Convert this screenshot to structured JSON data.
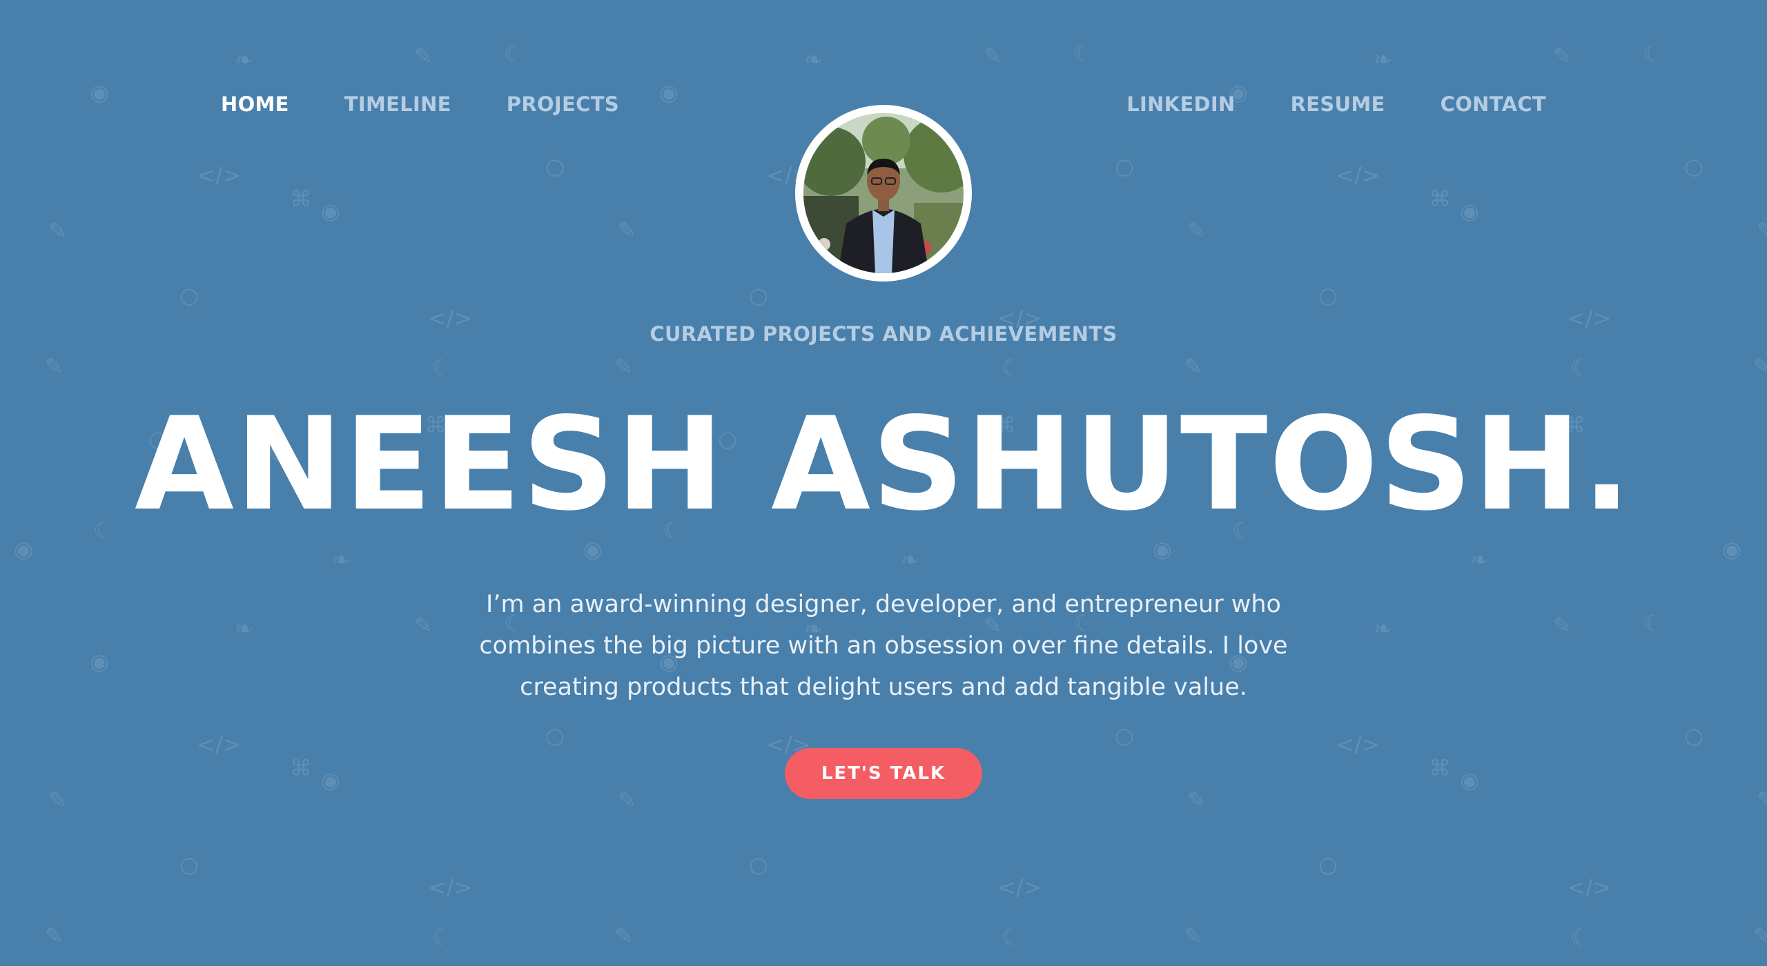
{
  "nav": {
    "left": [
      {
        "label": "HOME",
        "active": true
      },
      {
        "label": "TIMELINE",
        "active": false
      },
      {
        "label": "PROJECTS",
        "active": false
      }
    ],
    "right": [
      {
        "label": "LINKEDIN",
        "active": false
      },
      {
        "label": "RESUME",
        "active": false
      },
      {
        "label": "CONTACT",
        "active": false
      }
    ]
  },
  "hero": {
    "tagline": "CURATED PROJECTS AND ACHIEVEMENTS",
    "name": "ANEESH ASHUTOSH.",
    "bio": "I’m an award-winning designer, developer, and entrepreneur who combines the big picture with an obsession over fine details. I love creating products that delight users and add tangible value.",
    "cta_label": "LET'S TALK"
  },
  "colors": {
    "background": "#487fab",
    "nav_inactive": "#b4cde3",
    "nav_active": "#ffffff",
    "cta": "#f45d63"
  },
  "background_pattern_icons": [
    "bird-icon",
    "pencil-icon",
    "moon-icon",
    "location-pin-icon",
    "code-icon",
    "lightbulb-icon",
    "gamepad-icon"
  ]
}
